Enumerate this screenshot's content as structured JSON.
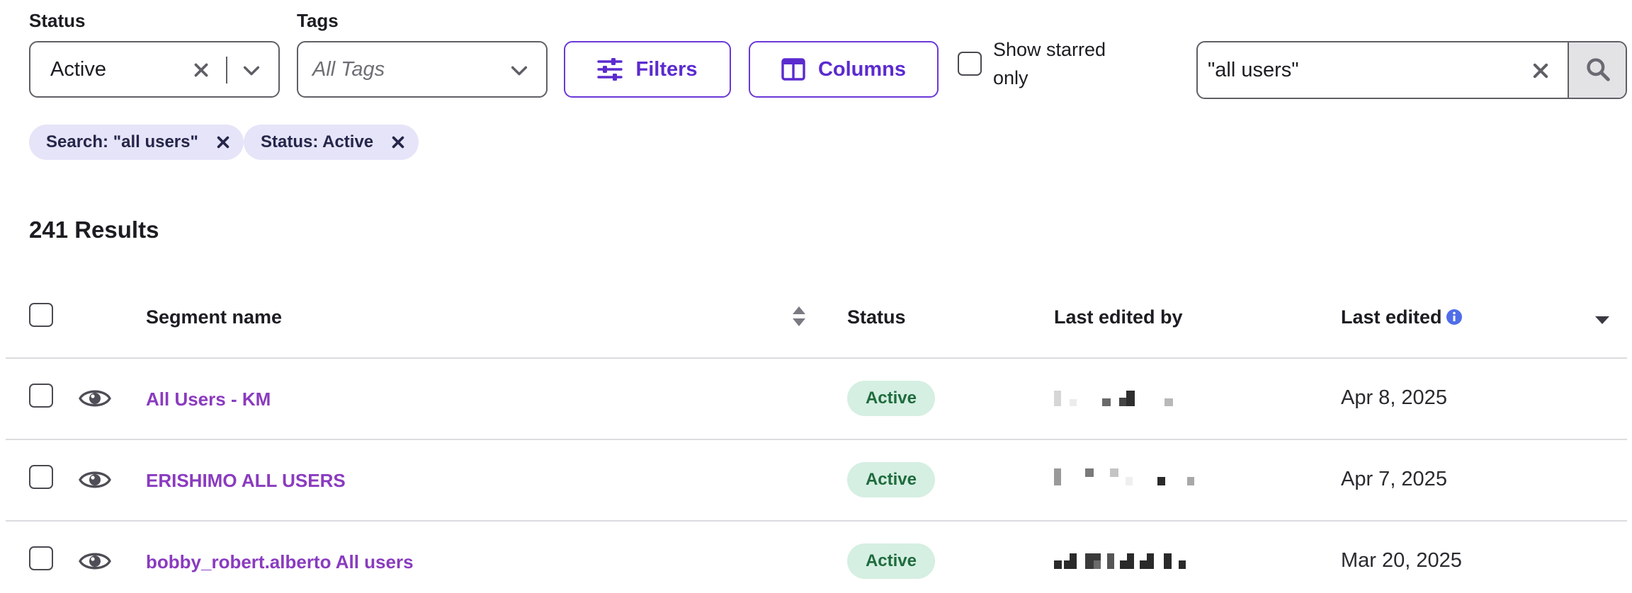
{
  "filters": {
    "status": {
      "label": "Status",
      "value": "Active",
      "clear_icon": "close-icon",
      "dropdown_icon": "chevron-down-icon"
    },
    "tags": {
      "label": "Tags",
      "placeholder": "All Tags",
      "dropdown_icon": "chevron-down-icon"
    },
    "filters_button": {
      "label": "Filters",
      "icon": "sliders-icon"
    },
    "columns_button": {
      "label": "Columns",
      "icon": "columns-icon"
    },
    "starred_only": {
      "label": "Show starred only",
      "checked": false
    },
    "search": {
      "value": "\"all users\"",
      "clear_icon": "close-icon",
      "submit_icon": "search-icon"
    }
  },
  "active_chips": [
    {
      "label": "Search: \"all users\""
    },
    {
      "label": "Status: Active"
    }
  ],
  "results": {
    "count_label": "241 Results"
  },
  "table": {
    "columns": {
      "segment_name": "Segment name",
      "status": "Status",
      "last_edited_by": "Last edited by",
      "last_edited": "Last edited"
    },
    "rows": [
      {
        "name": "All Users - KM",
        "status": "Active",
        "last_edited": "Apr 8, 2025"
      },
      {
        "name": "ERISHIMO ALL USERS",
        "status": "Active",
        "last_edited": "Apr 7, 2025"
      },
      {
        "name": "bobby_robert.alberto All users",
        "status": "Active",
        "last_edited": "Mar 20, 2025"
      }
    ]
  },
  "colors": {
    "accent": "#5b2bcf",
    "link": "#8a3bbf",
    "chip_bg": "#e6e4f8",
    "status_active_bg": "#d5efe2",
    "status_active_text": "#1f6b3d",
    "info_icon": "#4f6ee8"
  }
}
